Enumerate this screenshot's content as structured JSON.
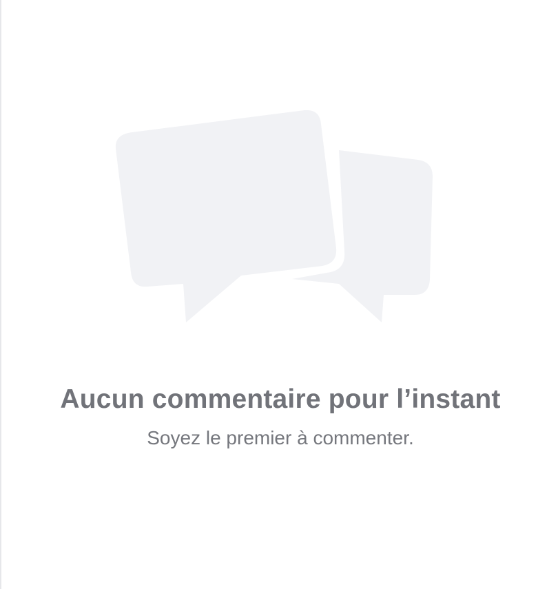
{
  "empty_state": {
    "icon": "speech-bubbles-icon",
    "title": "Aucun commentaire pour l’instant",
    "subtitle": "Soyez le premier à commenter.",
    "colors": {
      "bubble_fill": "#f1f2f5",
      "title_text": "#717379",
      "subtitle_text": "#75777d"
    }
  }
}
